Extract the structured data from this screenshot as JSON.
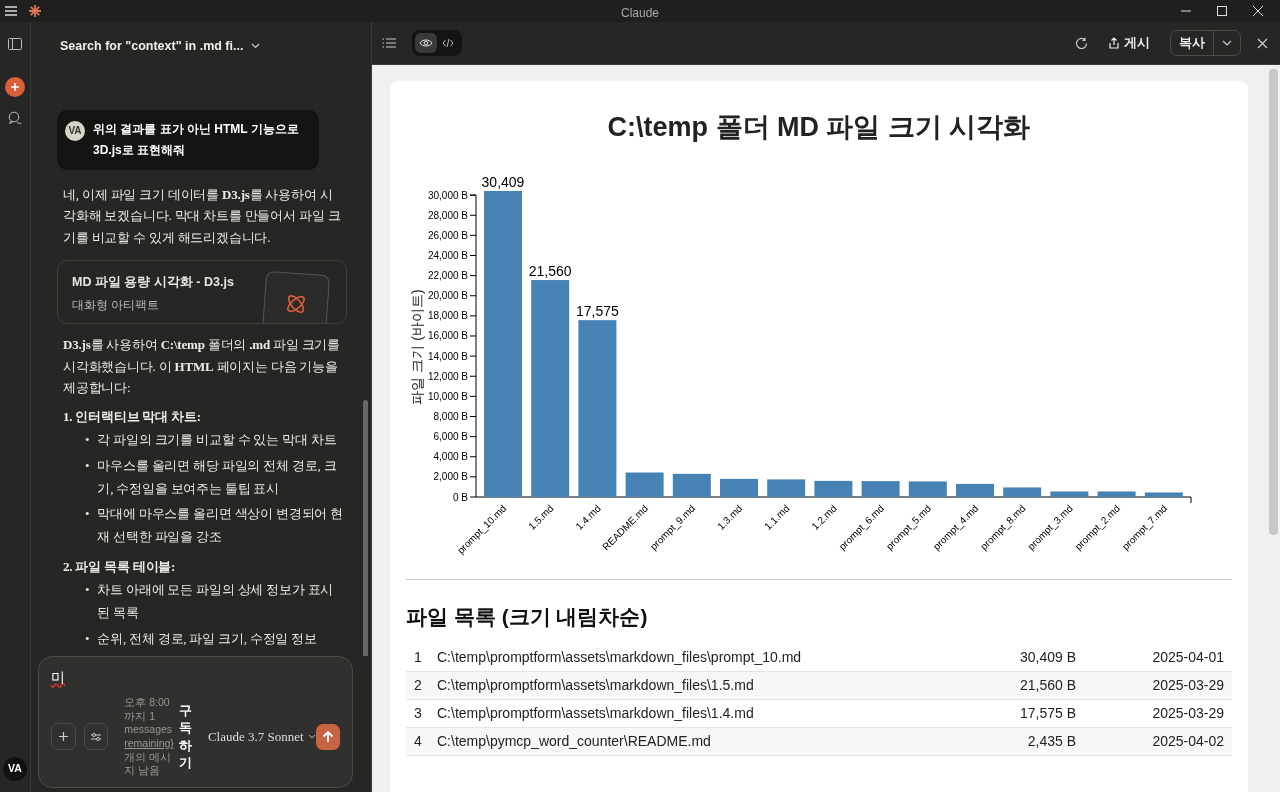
{
  "window": {
    "title": "Claude"
  },
  "sidebar": {
    "avatar": "VA"
  },
  "conversation": {
    "title": "Search for \"context\" in .md fi..."
  },
  "user_message": {
    "avatar": "VA",
    "text": "위의 결과를 표가 아닌 HTML 기능으로 3D.js로 표현해줘"
  },
  "assistant_intro": "네, 이제 파일 크기 데이터를 **D3.js**를 사용하여 시각화해 보겠습니다. 막대 차트를 만들어서 파일 크기를 비교할 수 있게 해드리겠습니다.",
  "artifact_card": {
    "title": "MD 파일 용량 시각화 - D3.js",
    "subtitle": "대화형 아티팩트"
  },
  "assistant_summary": "**D3.js**를 사용하여 **C:\\temp** 폴더의 **.md** 파일 크기를 시각화했습니다. 이 **HTML** 페이지는 다음 기능을 제공합니다:",
  "features": [
    {
      "number": "1.",
      "heading": "인터랙티브 막대 차트:",
      "marker": "•",
      "bullets": [
        "각 파일의 크기를 비교할 수 있는 막대 차트",
        "마우스를 올리면 해당 파일의 전체 경로, 크기, 수정일을 보여주는 툴팁 표시",
        "막대에 마우스를 올리면 색상이 변경되어 현재 선택한 파일을 강조"
      ]
    },
    {
      "number": "2.",
      "heading": "파일 목록 테이블:",
      "marker": "•",
      "bullets": [
        "차트 아래에 모든 파일의 상세 정보가 표시된 목록",
        "순위, 전체 경로, 파일 크기, 수정일 정보"
      ]
    }
  ],
  "composer": {
    "value": "미",
    "usage_before": "오후 8:00 까지 1 messages",
    "usage_link": "remaining}",
    "usage_after": "개의 메시지 남음",
    "subscribe": "구독하기",
    "model": "Claude 3.7 Sonnet"
  },
  "artifact_toolbar": {
    "views": [
      {
        "kind": "preview",
        "selected": true
      },
      {
        "kind": "code",
        "selected": false
      }
    ],
    "publish": "게시",
    "copy": "복사"
  },
  "artifact": {
    "title": "C:\\temp 폴더 MD 파일 크기 시각화",
    "chart_data": {
      "type": "bar",
      "ylabel": "파일 크기 (바이트)",
      "categories": [
        "prompt_10.md",
        "1.5.md",
        "1.4.md",
        "README.md",
        "prompt_9.md",
        "1.3.md",
        "1.1.md",
        "1.2.md",
        "prompt_6.md",
        "prompt_5.md",
        "prompt_4.md",
        "prompt_8.md",
        "prompt_3.md",
        "prompt_2.md",
        "prompt_7.md"
      ],
      "values": [
        30409,
        21560,
        17575,
        2435,
        2300,
        1800,
        1750,
        1600,
        1580,
        1550,
        1300,
        950,
        550,
        550,
        450
      ],
      "value_labels": [
        "30,409",
        "21,560",
        "17,575",
        null,
        null,
        null,
        null,
        null,
        null,
        null,
        null,
        null,
        null,
        null,
        null
      ],
      "ylim": [
        0,
        30409
      ],
      "yticks": [
        {
          "value": 0,
          "label": "0 B"
        },
        {
          "value": 2000,
          "label": "2,000 B"
        },
        {
          "value": 4000,
          "label": "4,000 B"
        },
        {
          "value": 6000,
          "label": "6,000 B"
        },
        {
          "value": 8000,
          "label": "8,000 B"
        },
        {
          "value": 10000,
          "label": "10,000 B"
        },
        {
          "value": 12000,
          "label": "12,000 B"
        },
        {
          "value": 14000,
          "label": "14,000 B"
        },
        {
          "value": 16000,
          "label": "16,000 B"
        },
        {
          "value": 18000,
          "label": "18,000 B"
        },
        {
          "value": 20000,
          "label": "20,000 B"
        },
        {
          "value": 22000,
          "label": "22,000 B"
        },
        {
          "value": 24000,
          "label": "24,000 B"
        },
        {
          "value": 26000,
          "label": "26,000 B"
        },
        {
          "value": 28000,
          "label": "28,000 B"
        },
        {
          "value": 30000,
          "label": "30,000 B"
        }
      ]
    },
    "table_title": "파일 목록 (크기 내림차순)",
    "rows": [
      {
        "rank": "1",
        "path": "C:\\temp\\promptform\\assets\\markdown_files\\prompt_10.md",
        "size": "30,409 B",
        "date": "2025-04-01"
      },
      {
        "rank": "2",
        "path": "C:\\temp\\promptform\\assets\\markdown_files\\1.5.md",
        "size": "21,560 B",
        "date": "2025-03-29"
      },
      {
        "rank": "3",
        "path": "C:\\temp\\promptform\\assets\\markdown_files\\1.4.md",
        "size": "17,575 B",
        "date": "2025-03-29"
      },
      {
        "rank": "4",
        "path": "C:\\temp\\pymcp_word_counter\\README.md",
        "size": "2,435 B",
        "date": "2025-04-02"
      }
    ]
  }
}
